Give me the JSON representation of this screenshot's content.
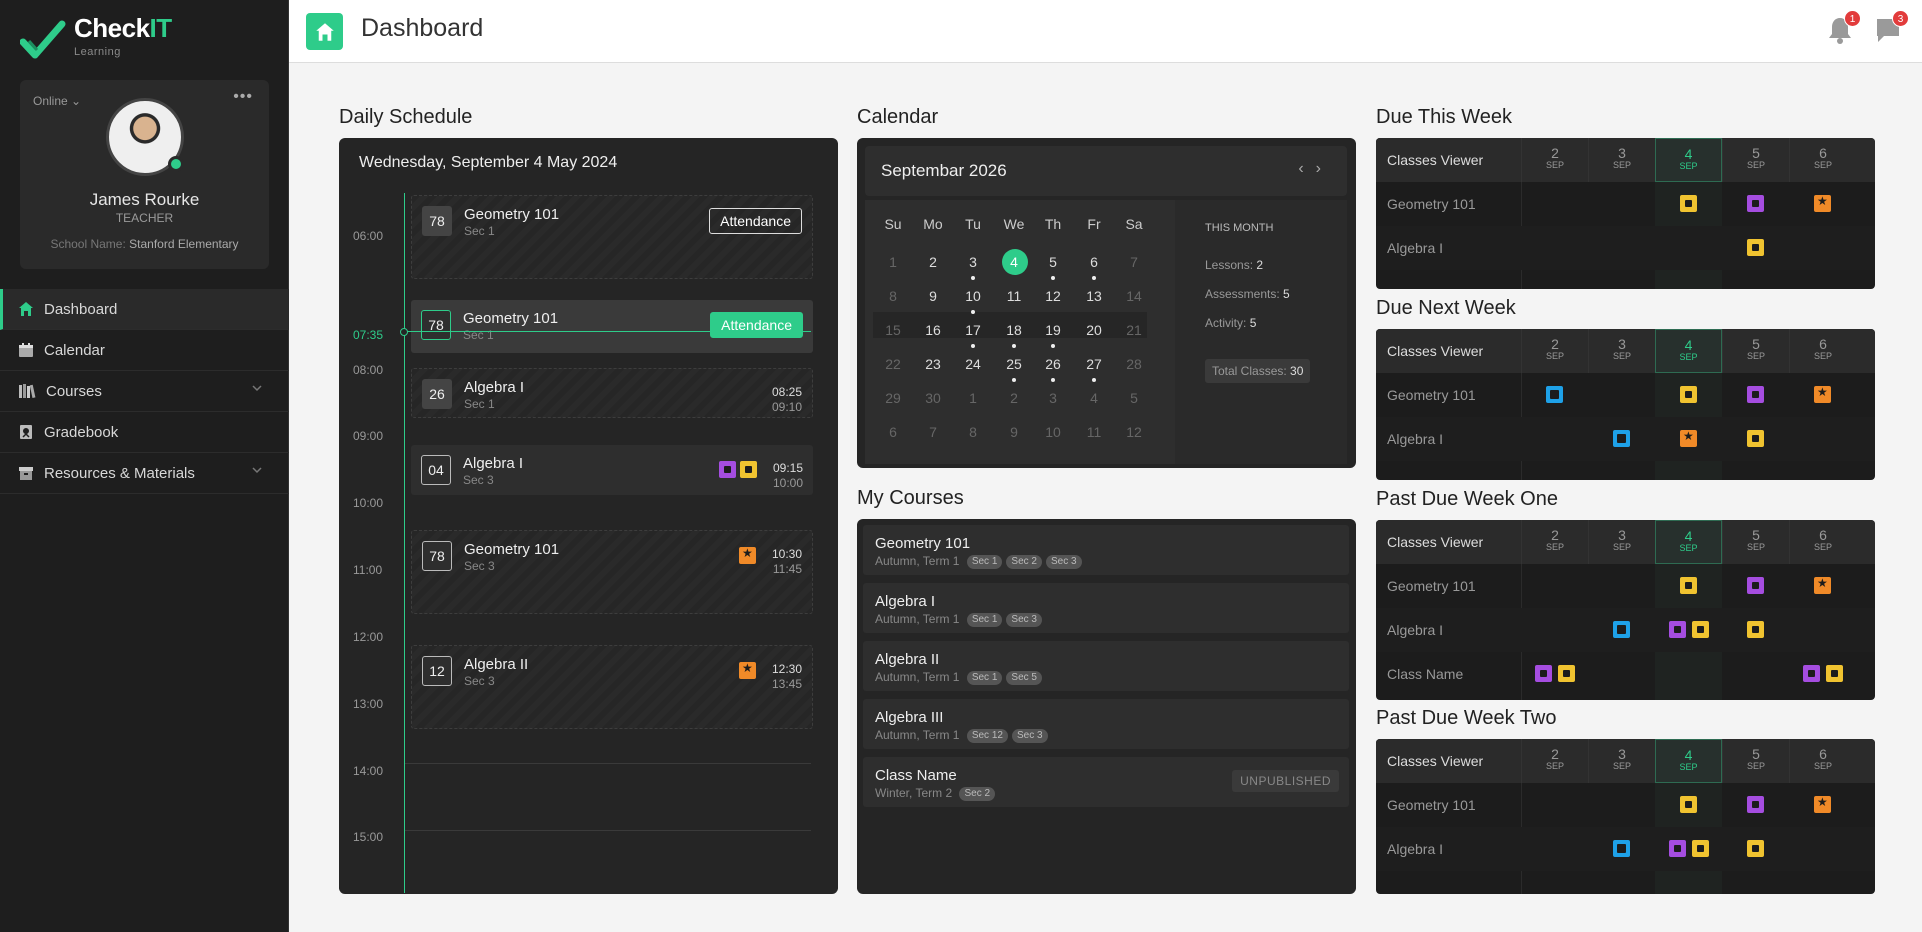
{
  "app": {
    "logo_main": "Check",
    "logo_accent": "IT",
    "logo_sub": "Learning"
  },
  "profile": {
    "status": "Online",
    "name": "James Rourke",
    "role": "TEACHER",
    "school_label": "School Name:",
    "school": "Stanford Elementary"
  },
  "nav": [
    {
      "label": "Dashboard",
      "icon": "home-icon"
    },
    {
      "label": "Calendar",
      "icon": "calendar-icon"
    },
    {
      "label": "Courses",
      "icon": "books-icon"
    },
    {
      "label": "Gradebook",
      "icon": "gradebook-icon"
    },
    {
      "label": "Resources & Materials",
      "icon": "box-icon"
    }
  ],
  "header": {
    "title": "Dashboard",
    "notifications": "1",
    "messages": "3"
  },
  "daily": {
    "title": "Daily Schedule",
    "date": "Wednesday, September 4 May 2024",
    "hours": [
      "06:00",
      "07:35",
      "08:00",
      "09:00",
      "10:00",
      "11:00",
      "12:00",
      "13:00",
      "14:00",
      "15:00"
    ],
    "items": [
      {
        "num": "78",
        "title": "Geometry 101",
        "sec": "Sec 1",
        "action": "Attendance"
      },
      {
        "num": "78",
        "title": "Geometry 101",
        "sec": "Sec 1",
        "action": "Attendance"
      },
      {
        "num": "26",
        "title": "Algebra I",
        "sec": "Sec 1",
        "start": "08:25",
        "end": "09:10"
      },
      {
        "num": "04",
        "title": "Algebra I",
        "sec": "Sec 3",
        "start": "09:15",
        "end": "10:00"
      },
      {
        "num": "78",
        "title": "Geometry 101",
        "sec": "Sec 3",
        "start": "10:30",
        "end": "11:45"
      },
      {
        "num": "12",
        "title": "Algebra II",
        "sec": "Sec 3",
        "start": "12:30",
        "end": "13:45"
      }
    ]
  },
  "calendar": {
    "section": "Calendar",
    "month": "Septembar 2026",
    "nav_prev": "‹",
    "nav_next": "›",
    "dow": [
      "Su",
      "Mo",
      "Tu",
      "We",
      "Th",
      "Fr",
      "Sa"
    ],
    "weeks": [
      [
        "1",
        "2",
        "3",
        "4",
        "5",
        "6",
        "7"
      ],
      [
        "8",
        "9",
        "10",
        "11",
        "12",
        "13",
        "14"
      ],
      [
        "15",
        "16",
        "17",
        "18",
        "19",
        "20",
        "21"
      ],
      [
        "22",
        "23",
        "24",
        "25",
        "26",
        "27",
        "28"
      ],
      [
        "29",
        "30",
        "1",
        "2",
        "3",
        "4",
        "5"
      ],
      [
        "6",
        "7",
        "8",
        "9",
        "10",
        "11",
        "12"
      ]
    ],
    "this_month": "THIS MONTH",
    "lessons_label": "Lessons:",
    "lessons": "2",
    "assessments_label": "Assessments:",
    "assessments": "5",
    "activity_label": "Activity:",
    "activity": "5",
    "total_label": "Total Classes:",
    "total": "30"
  },
  "courses": {
    "title": "My Courses",
    "items": [
      {
        "name": "Geometry 101",
        "term": "Autumn, Term 1",
        "tags": [
          "Sec 1",
          "Sec 2",
          "Sec 3"
        ]
      },
      {
        "name": "Algebra I",
        "term": "Autumn, Term 1",
        "tags": [
          "Sec 1",
          "Sec 3"
        ]
      },
      {
        "name": "Algebra II",
        "term": "Autumn, Term 1",
        "tags": [
          "Sec 1",
          "Sec 5"
        ]
      },
      {
        "name": "Algebra III",
        "term": "Autumn, Term 1",
        "tags": [
          "Sec 12",
          "Sec 3"
        ]
      },
      {
        "name": "Class Name",
        "term": "Winter, Term 2",
        "tags": [
          "Sec 2"
        ],
        "status": "UNPUBLISHED"
      }
    ]
  },
  "due": {
    "header_label": "Classes Viewer",
    "days": [
      {
        "n": "2",
        "m": "SEP"
      },
      {
        "n": "3",
        "m": "SEP"
      },
      {
        "n": "4",
        "m": "SEP"
      },
      {
        "n": "5",
        "m": "SEP"
      },
      {
        "n": "6",
        "m": "SEP"
      }
    ],
    "tables": [
      {
        "title": "Due This Week",
        "rows": [
          {
            "label": "Geometry 101",
            "cells": [
              [],
              [],
              [
                "y"
              ],
              [
                "p"
              ],
              [
                "o"
              ]
            ]
          },
          {
            "label": "Algebra I",
            "cells": [
              [],
              [],
              [],
              [
                "y"
              ],
              []
            ]
          }
        ]
      },
      {
        "title": "Due Next Week",
        "rows": [
          {
            "label": "Geometry 101",
            "cells": [
              [
                "b"
              ],
              [],
              [
                "y"
              ],
              [
                "p"
              ],
              [
                "o"
              ]
            ]
          },
          {
            "label": "Algebra I",
            "cells": [
              [],
              [
                "b"
              ],
              [
                "o"
              ],
              [
                "y"
              ],
              []
            ]
          }
        ]
      },
      {
        "title": "Past Due Week One",
        "rows": [
          {
            "label": "Geometry 101",
            "cells": [
              [],
              [],
              [
                "y"
              ],
              [
                "p"
              ],
              [
                "o"
              ]
            ]
          },
          {
            "label": "Algebra I",
            "cells": [
              [],
              [
                "b"
              ],
              [
                "p",
                "y"
              ],
              [
                "y"
              ],
              []
            ]
          },
          {
            "label": "Class Name",
            "cells": [
              [
                "p",
                "y"
              ],
              [],
              [],
              [],
              [
                "p",
                "y"
              ]
            ]
          }
        ]
      },
      {
        "title": "Past Due Week Two",
        "rows": [
          {
            "label": "Geometry 101",
            "cells": [
              [],
              [],
              [
                "y"
              ],
              [
                "p"
              ],
              [
                "o"
              ]
            ]
          },
          {
            "label": "Algebra I",
            "cells": [
              [],
              [
                "b"
              ],
              [
                "p",
                "y"
              ],
              [
                "y"
              ],
              []
            ]
          }
        ]
      }
    ]
  },
  "colors": {
    "accent": "#2ecc8a",
    "purple": "#a54de0",
    "yellow": "#f0c330",
    "orange": "#f08a28",
    "blue": "#1ea1e8"
  }
}
